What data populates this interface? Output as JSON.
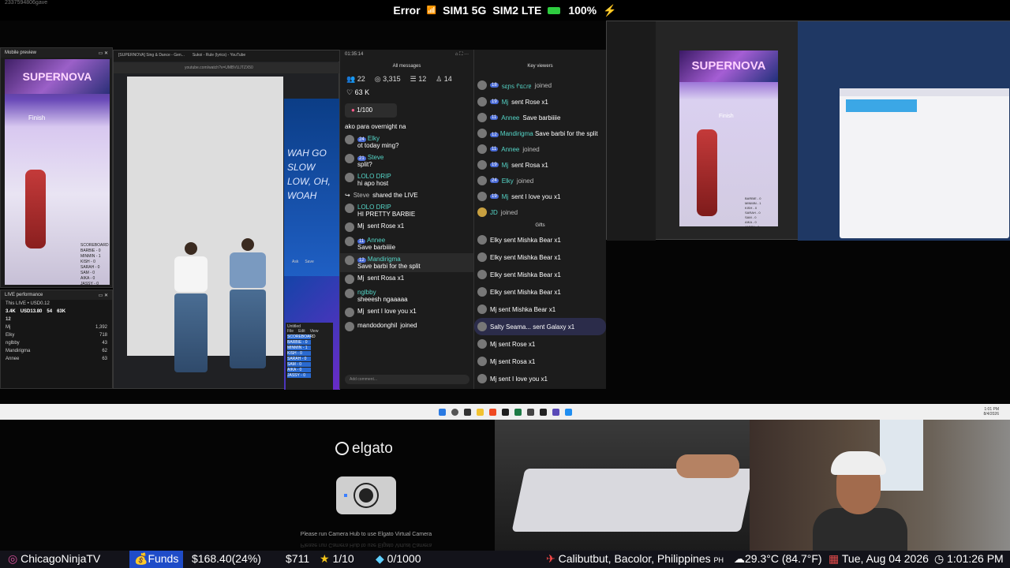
{
  "status_bar": {
    "tiny_label": "2337594806gave",
    "error": "Error",
    "sim1": "SIM1 5G",
    "sim2": "SIM2 LTE",
    "battery": "100%"
  },
  "mobile_preview": {
    "title": "Mobile preview",
    "banner": "SUPERNOVA",
    "finish": "Finish",
    "scoreboard": [
      "SCOREBOARD",
      "BARBIE - 0",
      "MINMIN - 1",
      "KISH - 0",
      "SARAH - 0",
      "SAM - 0",
      "AIKA - 0",
      "JASSY - 0"
    ]
  },
  "live_performance": {
    "title": "LIVE performance",
    "subtitle": "This LIVE • USD0.12",
    "stats": [
      "3.4K",
      "USD13.80",
      "54",
      "63K"
    ],
    "count": "12",
    "rows": [
      {
        "name": "Mj",
        "value": "1,392"
      },
      {
        "name": "Elky",
        "value": "718"
      },
      {
        "name": "nglbby",
        "value": "43"
      },
      {
        "name": "Mandirigma",
        "value": "62"
      },
      {
        "name": "Annee",
        "value": "63"
      }
    ]
  },
  "browser": {
    "tabs": [
      "[SUPERNOVA] Sing & Dance - Gen...",
      "Sukoi - Rule (lyrics) - YouTube"
    ],
    "url": "youtube.com/watch?v=UMBVUJTZX50",
    "lyrics": [
      "WAH GO SLOW",
      "LOW, OH, WOAH"
    ],
    "notepad_title": "Untitled",
    "notepad_menu": [
      "File",
      "Edit",
      "View"
    ],
    "notepad_lines": [
      "SCOREBOARD",
      "BARBIE - 0",
      "MINMIN - 1",
      "KISH - 0",
      "SARAH - 0",
      "SAM - 0",
      "AIKA - 0",
      "JASSY - 0"
    ],
    "buttons": [
      "Ask",
      "Save"
    ]
  },
  "chat": {
    "timer": "01:35:14",
    "tab": "All messages",
    "stats": {
      "viewers": "22",
      "views": "3,315",
      "comments": "12",
      "follows": "14"
    },
    "likes": "63 K",
    "goal": "1/100",
    "messages": [
      {
        "name": "",
        "text": "ako para overnight na"
      },
      {
        "name": "Elky",
        "text": "ot today ming?"
      },
      {
        "name": "Steve",
        "text": "split?"
      },
      {
        "name": "LOLO DRIP",
        "text": "hi apo host"
      },
      {
        "name": "Steve",
        "text": "shared the LIVE"
      },
      {
        "name": "LOLO DRIP",
        "text": "HI PRETTY BARBIE"
      },
      {
        "name": "Mj",
        "text": "sent Rose x1"
      },
      {
        "name": "Annee",
        "text": "Save barbiiiie"
      },
      {
        "name": "Mandirigma",
        "text": "Save barbi for the split"
      },
      {
        "name": "Mj",
        "text": "sent Rosa x1"
      },
      {
        "name": "nglbby",
        "text": "sheeesh ngaaaaa"
      },
      {
        "name": "Mj",
        "text": "sent I love you x1"
      },
      {
        "name": "mandodonghil",
        "text": "joined"
      }
    ],
    "input_placeholder": "Add comment..."
  },
  "key_viewers": {
    "title": "Key viewers",
    "rows": [
      {
        "name": "ꜱɛɲꜱ ᠻᥲᥴɾᥱ",
        "text": "joined"
      },
      {
        "name": "Mj",
        "text": "sent Rose x1"
      },
      {
        "name": "Annee",
        "text": "Save barbiiiie"
      },
      {
        "name": "Mandirigma",
        "text": "Save barbi for the split"
      },
      {
        "name": "Annee",
        "text": "joined"
      },
      {
        "name": "Mj",
        "text": "sent Rosa x1"
      },
      {
        "name": "Elky",
        "text": "joined"
      },
      {
        "name": "Mj",
        "text": "sent I love you x1"
      },
      {
        "name": "JD",
        "text": "joined"
      }
    ],
    "gifts_title": "Gifts",
    "gifts": [
      "Elky sent Mishka Bear x1",
      "Elky sent Mishka Bear x1",
      "Elky sent Mishka Bear x1",
      "Elky sent Mishka Bear x1",
      "Mj sent Mishka Bear x1",
      "Salty Seama... sent Galaxy x1",
      "Mj sent Rose x1",
      "Mj sent Rosa x1",
      "Mj sent I love you x1"
    ]
  },
  "obs": {
    "banner": "SUPERNOVA",
    "finish": "Finish",
    "scoreboard": [
      "BARBIE - 0",
      "MINMIN - 1",
      "KISH - 0",
      "SARAH - 0",
      "SAM - 0",
      "AIKA - 0",
      "JASSY - 0"
    ]
  },
  "taskbar": {
    "clock": "1:01 PM",
    "date": "8/4/2026"
  },
  "elgato": {
    "logo": "elgato",
    "message": "Please run Camera Hub to use Elgato Virtual Camera",
    "message_reflection": "Please run Camera Hub to use Elgato Virtual Camera"
  },
  "ticker": {
    "handle": "ChicagoNinjaTV",
    "funds_label": "Funds",
    "funds_value": "$168.40(24%)",
    "cash": "$711",
    "ratio": "1/10",
    "gems": "0/1000",
    "location": "Calibutbut, Bacolor, Philippines",
    "location_code": "PH",
    "weather": "29.3°C (84.7°F)",
    "date": "Tue, Aug 04 2026",
    "time": "1:01:26 PM"
  },
  "colors": {
    "accent": "#1f4cc8",
    "tiktok_name": "#55d6c8",
    "level_badge": "#4a6bd6",
    "battery": "#2ecc40"
  }
}
